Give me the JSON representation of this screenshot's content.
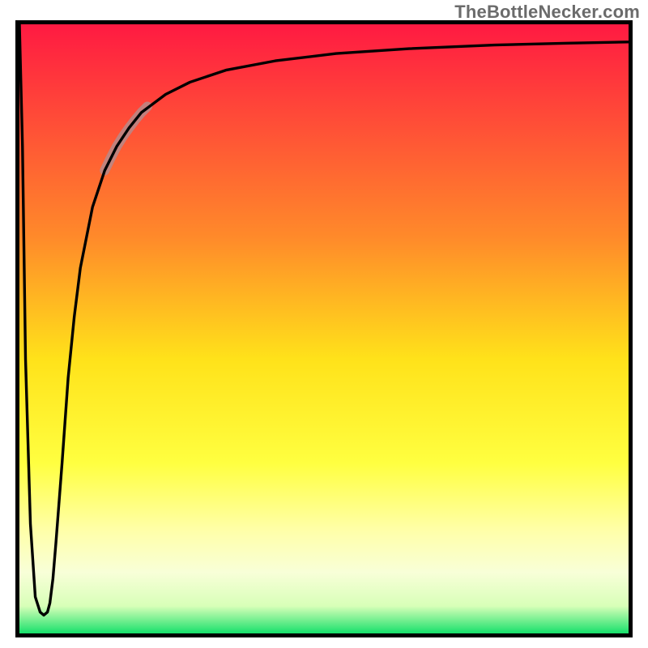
{
  "attribution": "TheBottleNecker.com",
  "chart_data": {
    "type": "line",
    "title": "",
    "xlabel": "",
    "ylabel": "",
    "xlim": [
      0,
      100
    ],
    "ylim": [
      0,
      100
    ],
    "grid": false,
    "legend": false,
    "gradient_stops": [
      {
        "offset": 0,
        "color": "#ff1a42"
      },
      {
        "offset": 0.35,
        "color": "#ff8a2a"
      },
      {
        "offset": 0.55,
        "color": "#ffe21a"
      },
      {
        "offset": 0.72,
        "color": "#ffff40"
      },
      {
        "offset": 0.83,
        "color": "#ffffa8"
      },
      {
        "offset": 0.9,
        "color": "#f8ffd8"
      },
      {
        "offset": 0.955,
        "color": "#d8ffb8"
      },
      {
        "offset": 1.0,
        "color": "#17e06b"
      }
    ],
    "series": [
      {
        "name": "curve",
        "color": "#000000",
        "x": [
          0,
          0.5,
          1.0,
          1.8,
          2.6,
          3.4,
          4.0,
          4.6,
          5.0,
          5.5,
          6.0,
          7.0,
          8.0,
          9.0,
          10.0,
          12.0,
          14.0,
          16.0,
          18.0,
          20.0,
          24.0,
          28.0,
          34.0,
          42.0,
          52.0,
          64.0,
          78.0,
          90.0,
          100.0
        ],
        "y": [
          100,
          80,
          45,
          18,
          6,
          3.5,
          3.0,
          3.5,
          5.0,
          9.0,
          15.0,
          28.0,
          42.0,
          52.0,
          60.0,
          70.0,
          76.0,
          80.0,
          83.0,
          85.5,
          88.5,
          90.5,
          92.5,
          94.0,
          95.2,
          96.0,
          96.6,
          96.9,
          97.1
        ]
      }
    ],
    "highlight": {
      "color": "#b78989",
      "opacity": 0.85,
      "width": 12,
      "x": [
        14.0,
        15.0,
        16.0,
        17.0,
        18.0,
        19.0,
        20.0,
        21.0
      ],
      "y": [
        76.0,
        78.1,
        80.0,
        81.6,
        83.0,
        84.3,
        85.5,
        86.5
      ]
    }
  }
}
